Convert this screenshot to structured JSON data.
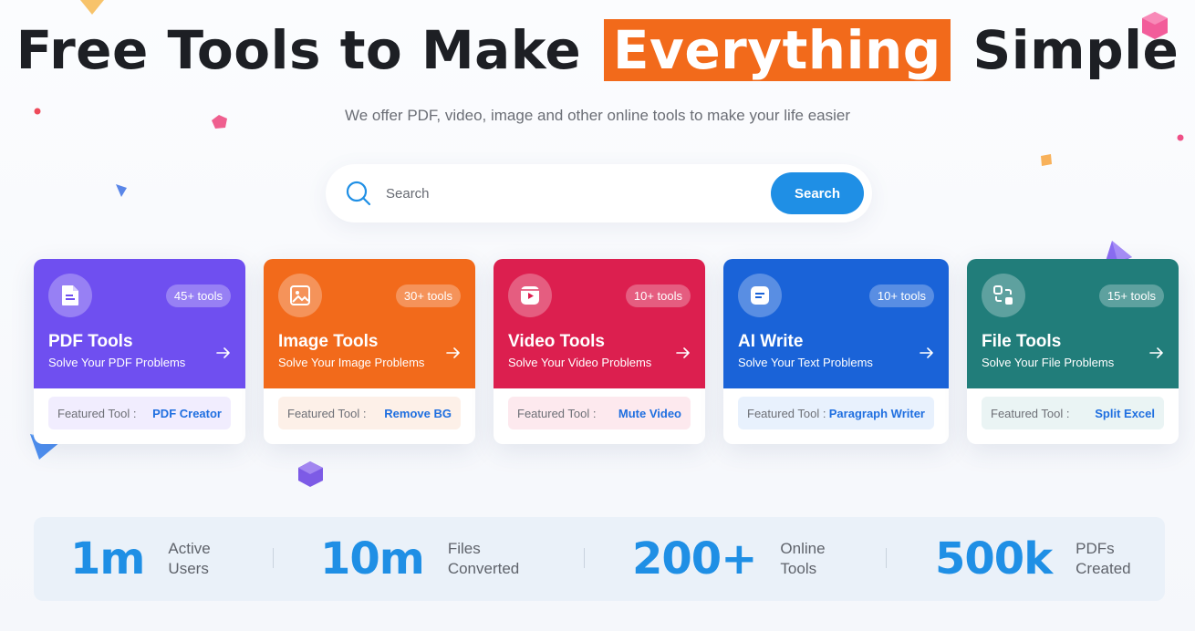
{
  "hero": {
    "title_before": "Free Tools to Make",
    "title_highlight": "Everything",
    "title_after": "Simple",
    "subtitle": "We offer PDF, video, image and other online tools to make your life easier"
  },
  "search": {
    "placeholder": "Search",
    "button_label": "Search"
  },
  "colors": {
    "accent_orange": "#f26a1b",
    "primary_blue": "#1f8fe5",
    "pdf": "#6f4ff0",
    "image": "#f26a1b",
    "video": "#dc1f4f",
    "ai": "#1a63d8",
    "file": "#217d7a"
  },
  "cards": [
    {
      "title": "PDF Tools",
      "desc": "Solve Your PDF Problems",
      "badge": "45+ tools",
      "featured_label": "Featured Tool :",
      "featured_tool": "PDF Creator",
      "icon": "pdf-file-icon"
    },
    {
      "title": "Image Tools",
      "desc": "Solve Your Image Problems",
      "badge": "30+ tools",
      "featured_label": "Featured Tool :",
      "featured_tool": "Remove BG",
      "icon": "image-icon"
    },
    {
      "title": "Video Tools",
      "desc": "Solve Your Video Problems",
      "badge": "10+ tools",
      "featured_label": "Featured Tool :",
      "featured_tool": "Mute Video",
      "icon": "video-play-icon"
    },
    {
      "title": "AI Write",
      "desc": "Solve Your Text Problems",
      "badge": "10+ tools",
      "featured_label": "Featured Tool :",
      "featured_tool": "Paragraph Writer",
      "icon": "text-document-icon"
    },
    {
      "title": "File Tools",
      "desc": "Solve Your File Problems",
      "badge": "15+ tools",
      "featured_label": "Featured Tool :",
      "featured_tool": "Split Excel",
      "icon": "file-convert-icon"
    }
  ],
  "stats": [
    {
      "number": "1m",
      "label_line1": "Active",
      "label_line2": "Users"
    },
    {
      "number": "10m",
      "label_line1": "Files",
      "label_line2": "Converted"
    },
    {
      "number": "200+",
      "label_line1": "Online",
      "label_line2": "Tools"
    },
    {
      "number": "500k",
      "label_line1": "PDFs",
      "label_line2": "Created"
    }
  ]
}
